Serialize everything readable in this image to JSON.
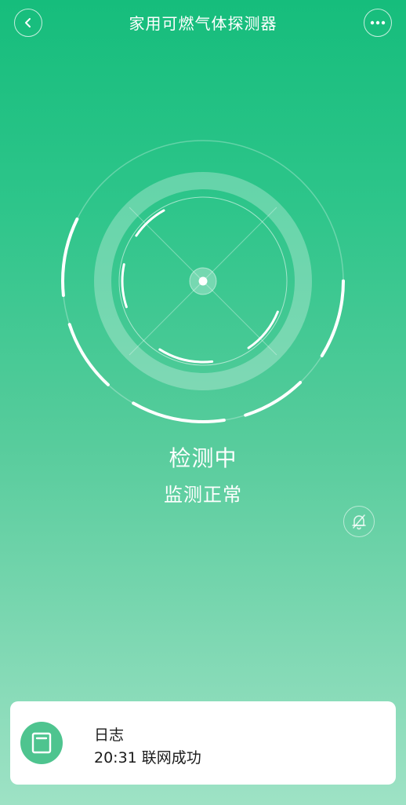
{
  "header": {
    "title": "家用可燃气体探测器",
    "back_icon": "chevron-left-icon",
    "more_icon": "more-dots-icon"
  },
  "status": {
    "main": "检测中",
    "sub": "监测正常"
  },
  "mute": {
    "icon": "bell-off-icon"
  },
  "log": {
    "title": "日志",
    "entry": "20:31 联网成功",
    "icon": "log-book-icon"
  },
  "colors": {
    "gradient_top": "#16bd7c",
    "gradient_bottom": "#9ee2c5",
    "log_icon_bg": "#4ec48f"
  }
}
